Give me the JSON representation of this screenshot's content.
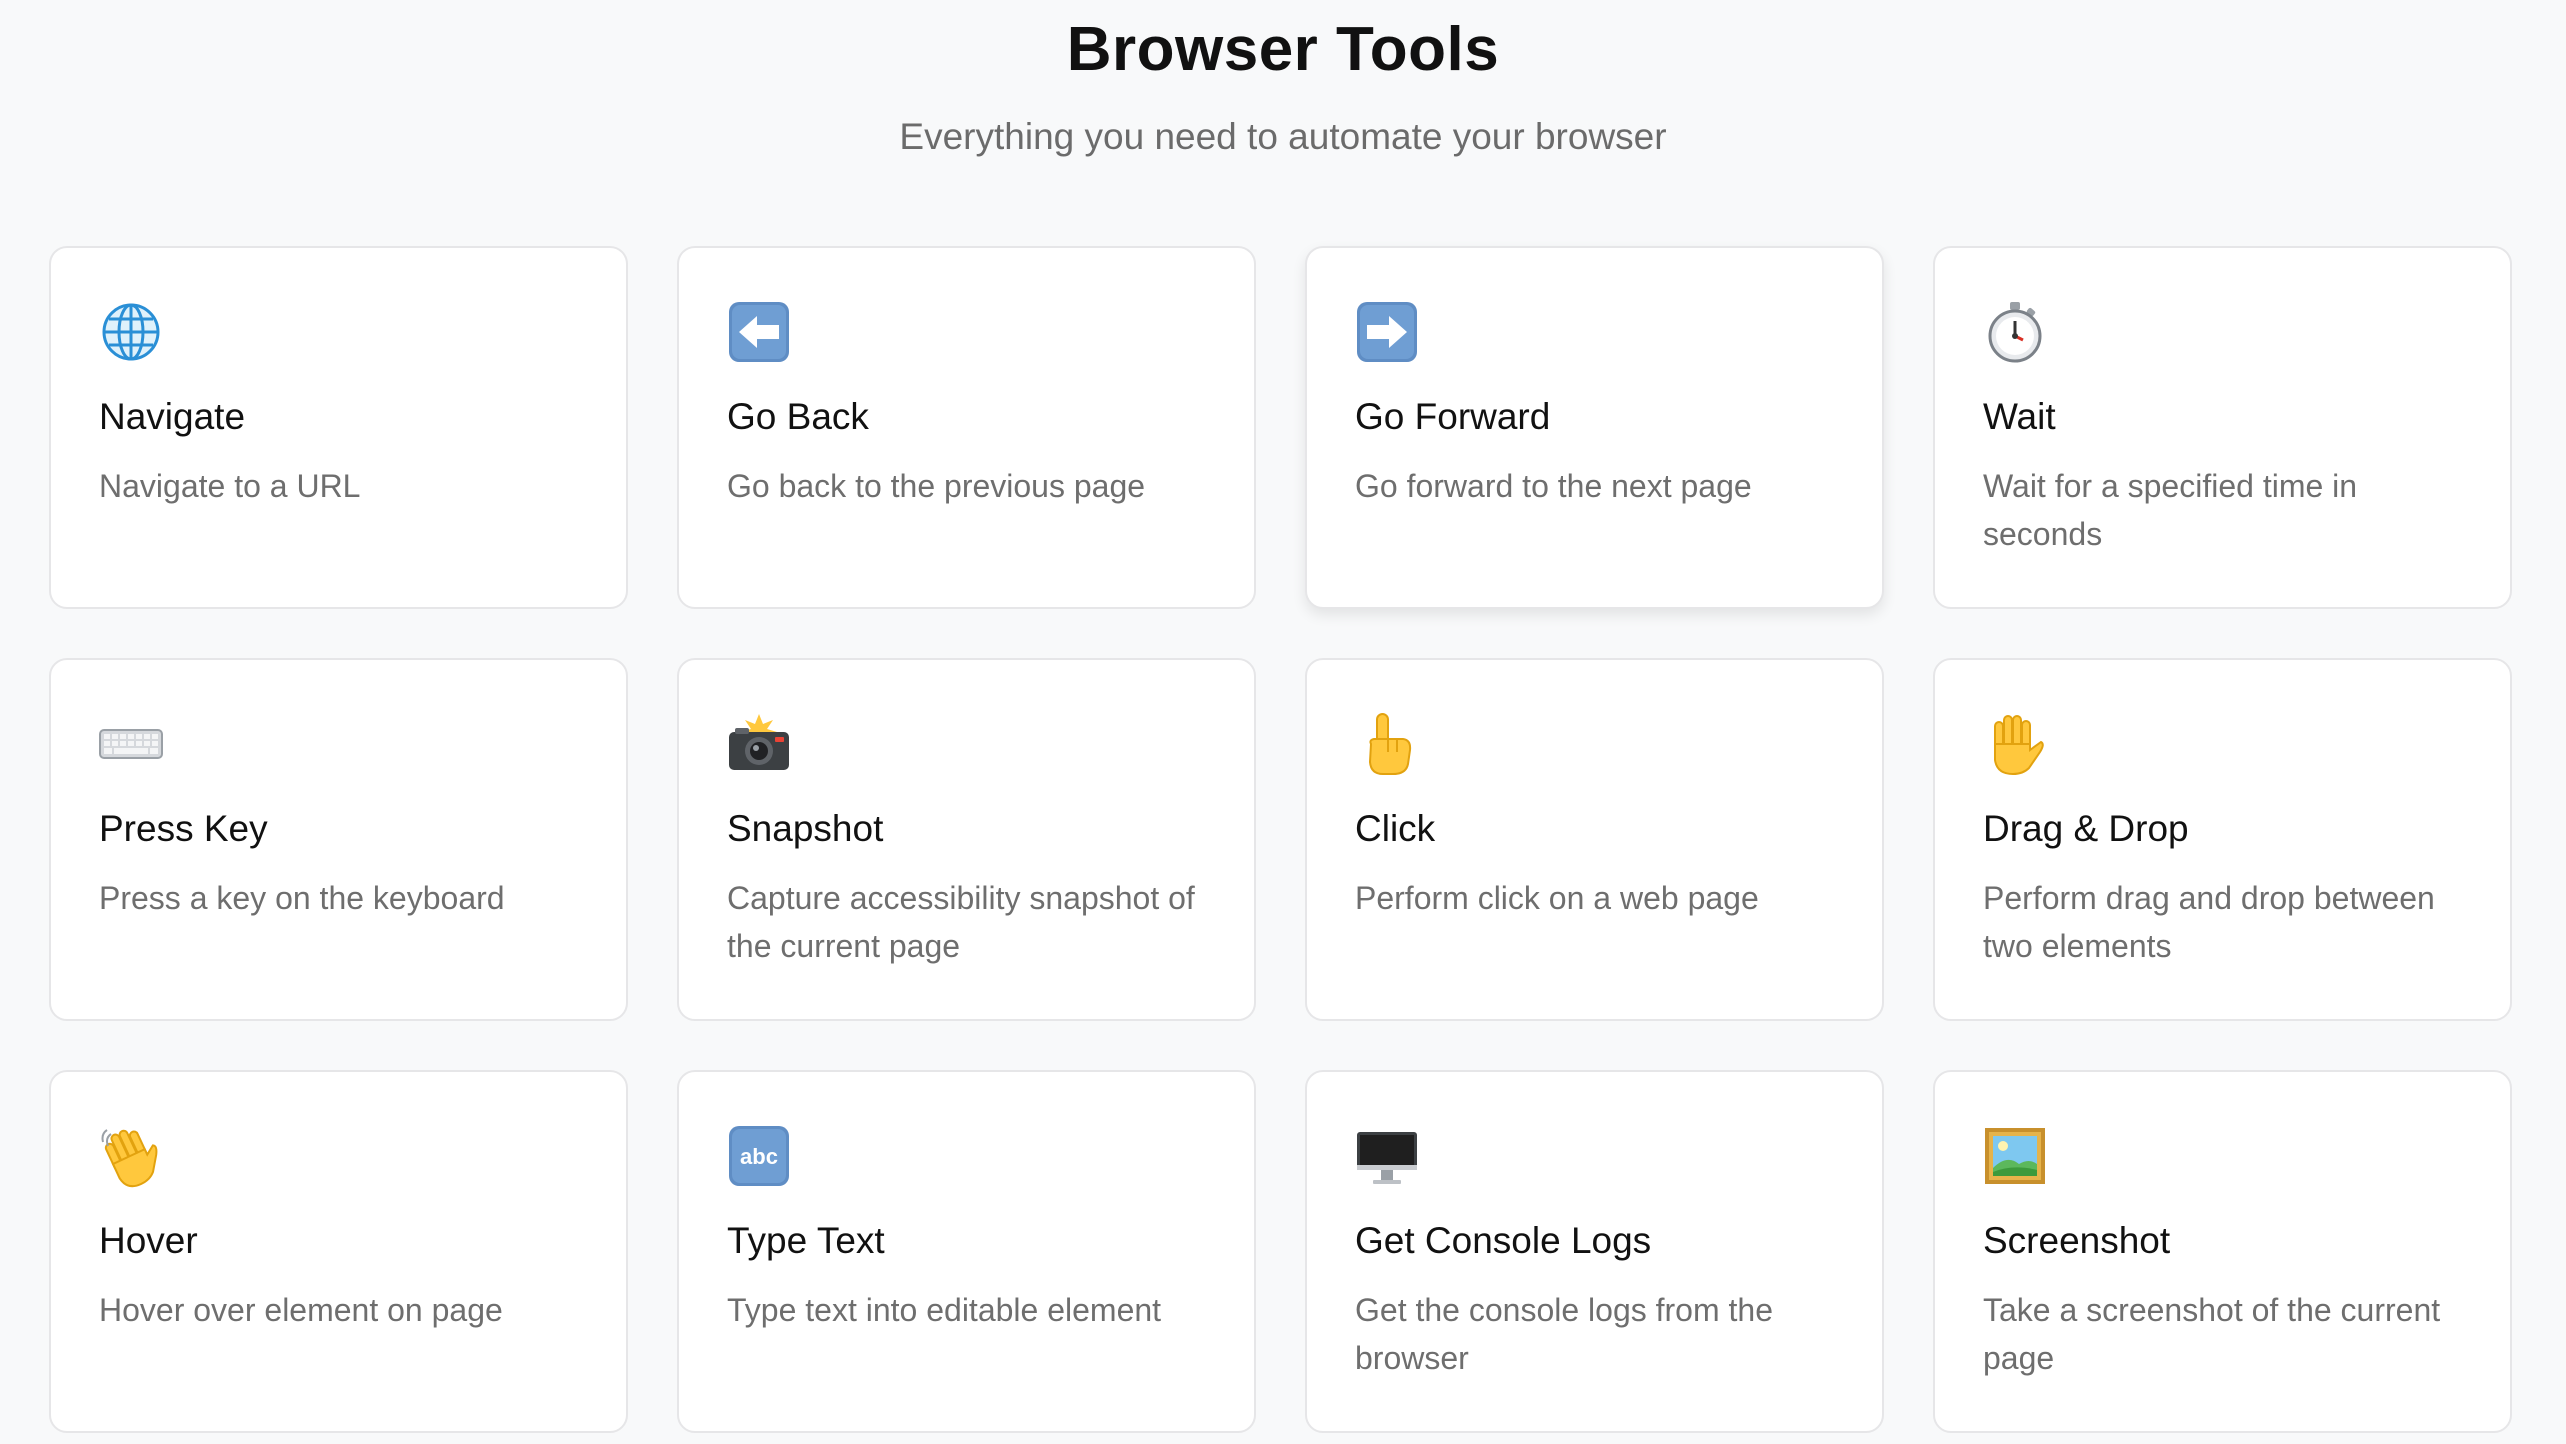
{
  "header": {
    "title": "Browser Tools",
    "subtitle": "Everything you need to automate your browser"
  },
  "tools": [
    {
      "icon": "globe-icon",
      "title": "Navigate",
      "description": "Navigate to a URL"
    },
    {
      "icon": "left-arrow-icon",
      "title": "Go Back",
      "description": "Go back to the previous page"
    },
    {
      "icon": "right-arrow-icon",
      "title": "Go Forward",
      "description": "Go forward to the next page"
    },
    {
      "icon": "stopwatch-icon",
      "title": "Wait",
      "description": "Wait for a specified time in seconds"
    },
    {
      "icon": "keyboard-icon",
      "title": "Press Key",
      "description": "Press a key on the keyboard"
    },
    {
      "icon": "camera-flash-icon",
      "title": "Snapshot",
      "description": "Capture accessibility snapshot of the current page"
    },
    {
      "icon": "pointing-finger-icon",
      "title": "Click",
      "description": "Perform click on a web page"
    },
    {
      "icon": "raised-hand-icon",
      "title": "Drag & Drop",
      "description": "Perform drag and drop between two elements"
    },
    {
      "icon": "waving-hand-icon",
      "title": "Hover",
      "description": "Hover over element on page"
    },
    {
      "icon": "abc-icon",
      "title": "Type Text",
      "description": "Type text into editable element",
      "icon_text": "abc"
    },
    {
      "icon": "desktop-computer-icon",
      "title": "Get Console Logs",
      "description": "Get the console logs from the browser"
    },
    {
      "icon": "framed-picture-icon",
      "title": "Screenshot",
      "description": "Take a screenshot of the current page"
    }
  ]
}
